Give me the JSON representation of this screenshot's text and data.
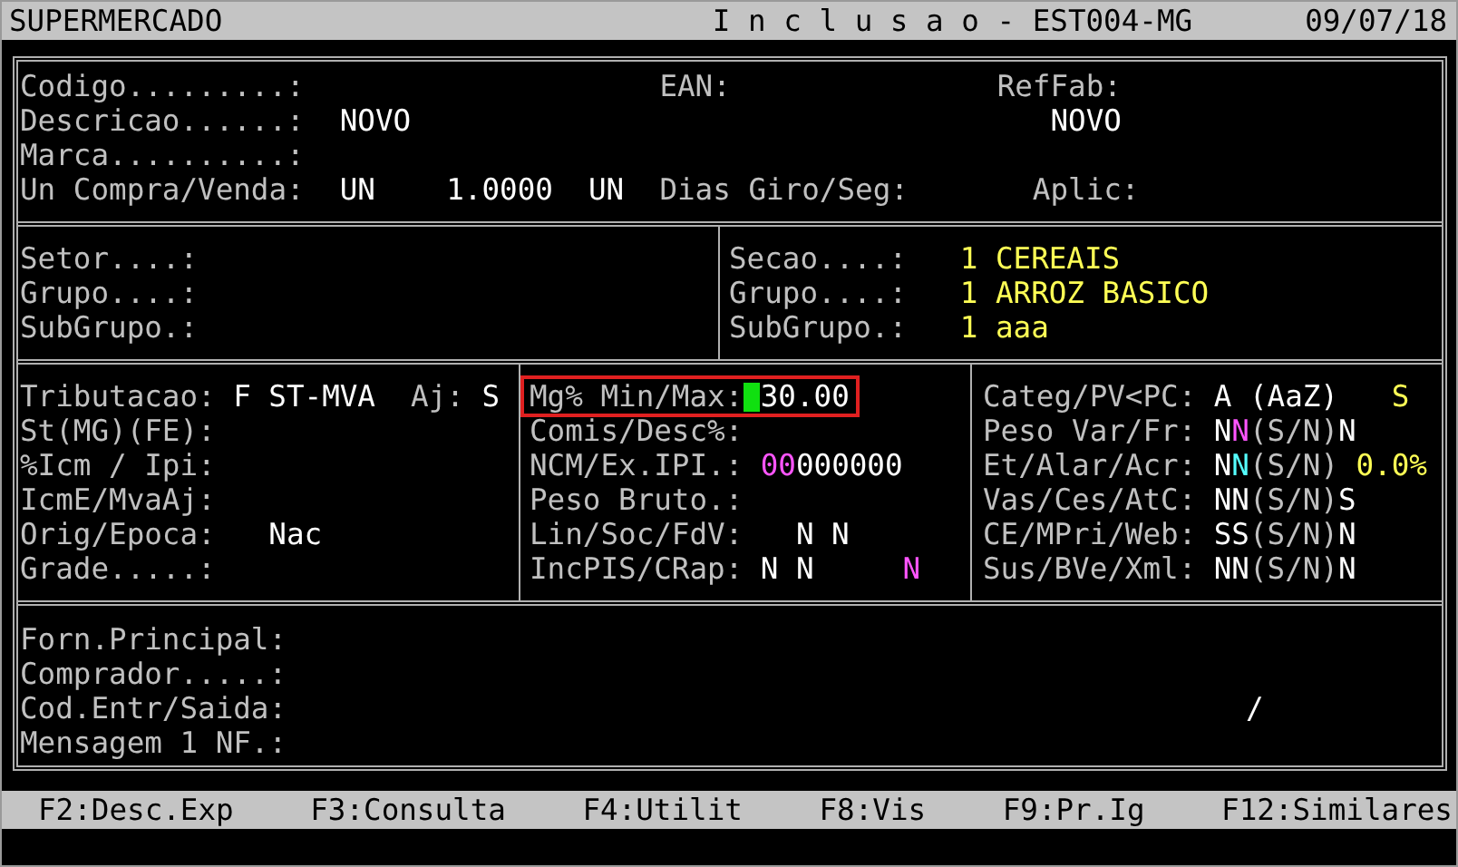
{
  "title_bar": {
    "system": "SUPERMERCADO",
    "screen": "I n c l u s a o - EST004-MG",
    "date": "09/07/18"
  },
  "sections": [
    {
      "panels": [
        {
          "lines": [
            {
              "items": [
                {
                  "kind": "label",
                  "text": "Codigo.........:"
                },
                {
                  "kind": "label",
                  "text": "EAN:"
                },
                {
                  "kind": "label",
                  "text": "RefFab:"
                }
              ]
            },
            {
              "items": [
                {
                  "kind": "label",
                  "text": "Descricao......:"
                },
                {
                  "kind": "value",
                  "parts": [
                    {
                      "text": "NOVO",
                      "color": "#ffffff"
                    }
                  ]
                },
                {
                  "kind": "value",
                  "parts": [
                    {
                      "text": "NOVO",
                      "color": "#ffffff"
                    }
                  ]
                }
              ]
            },
            {
              "items": [
                {
                  "kind": "label",
                  "text": "Marca..........:"
                }
              ]
            },
            {
              "items": [
                {
                  "kind": "label",
                  "text": "Un Compra/Venda:"
                },
                {
                  "kind": "value",
                  "parts": [
                    {
                      "text": "UN",
                      "color": "#ffffff"
                    }
                  ]
                },
                {
                  "kind": "value",
                  "parts": [
                    {
                      "text": "1.0000",
                      "color": "#ffffff"
                    }
                  ]
                },
                {
                  "kind": "value",
                  "parts": [
                    {
                      "text": "UN",
                      "color": "#ffffff"
                    }
                  ]
                },
                {
                  "kind": "label",
                  "text": "Dias Giro/Seg:"
                },
                {
                  "kind": "label",
                  "text": "Aplic:"
                }
              ]
            }
          ]
        }
      ]
    },
    {
      "panels": [
        {
          "lines": [
            {
              "items": [
                {
                  "kind": "label",
                  "text": "Setor....:"
                }
              ]
            },
            {
              "items": [
                {
                  "kind": "label",
                  "text": "Grupo....:"
                }
              ]
            },
            {
              "items": [
                {
                  "kind": "label",
                  "text": "SubGrupo.:"
                }
              ]
            }
          ]
        },
        {
          "lines": [
            {
              "items": [
                {
                  "kind": "label",
                  "text": "Secao....:"
                },
                {
                  "kind": "value",
                  "parts": [
                    {
                      "text": "1 CEREAIS",
                      "color": "#ffff55"
                    }
                  ]
                }
              ]
            },
            {
              "items": [
                {
                  "kind": "label",
                  "text": "Grupo....:"
                },
                {
                  "kind": "value",
                  "parts": [
                    {
                      "text": "1 ARROZ BASICO",
                      "color": "#ffff55"
                    }
                  ]
                }
              ]
            },
            {
              "items": [
                {
                  "kind": "label",
                  "text": "SubGrupo.:"
                },
                {
                  "kind": "value",
                  "parts": [
                    {
                      "text": "1 aaa",
                      "color": "#ffff55"
                    }
                  ]
                }
              ]
            }
          ]
        }
      ]
    },
    {
      "panels": [
        {
          "lines": [
            {
              "items": [
                {
                  "kind": "label",
                  "text": "Tributacao:"
                },
                {
                  "kind": "value",
                  "parts": [
                    {
                      "text": "F",
                      "color": "#ffffff"
                    }
                  ]
                },
                {
                  "kind": "value",
                  "parts": [
                    {
                      "text": "ST-MVA",
                      "color": "#ffffff"
                    }
                  ]
                },
                {
                  "kind": "label",
                  "text": "Aj:"
                },
                {
                  "kind": "value",
                  "parts": [
                    {
                      "text": "S",
                      "color": "#ffffff"
                    }
                  ]
                }
              ]
            },
            {
              "items": [
                {
                  "kind": "label",
                  "text": "St(MG)(FE):"
                }
              ]
            },
            {
              "items": [
                {
                  "kind": "label",
                  "text": "%Icm / Ipi:"
                }
              ]
            },
            {
              "items": [
                {
                  "kind": "label",
                  "text": "IcmE/MvaAj:"
                }
              ]
            },
            {
              "items": [
                {
                  "kind": "label",
                  "text": "Orig/Epoca:"
                },
                {
                  "kind": "value",
                  "parts": [
                    {
                      "text": "Nac",
                      "color": "#ffffff"
                    }
                  ]
                }
              ]
            },
            {
              "items": [
                {
                  "kind": "label",
                  "text": "Grade.....:"
                }
              ]
            }
          ]
        },
        {
          "lines": [
            {
              "items": [
                {
                  "kind": "label",
                  "text": "Mg% Min/Max:"
                },
                {
                  "kind": "value",
                  "focused": true,
                  "parts": [
                    {
                      "text": "30.00"
                    }
                  ]
                }
              ]
            },
            {
              "items": [
                {
                  "kind": "label",
                  "text": "Comis/Desc%:"
                }
              ]
            },
            {
              "items": [
                {
                  "kind": "label",
                  "text": "NCM/Ex.IPI.:"
                },
                {
                  "kind": "value",
                  "parts": [
                    {
                      "text": "00",
                      "color": "#ff55ff"
                    },
                    {
                      "text": "000000",
                      "color": "#ffffff"
                    }
                  ]
                }
              ]
            },
            {
              "items": [
                {
                  "kind": "label",
                  "text": "Peso Bruto.:"
                }
              ]
            },
            {
              "items": [
                {
                  "kind": "label",
                  "text": "Lin/Soc/FdV:"
                },
                {
                  "kind": "value",
                  "parts": [
                    {
                      "text": "N N",
                      "color": "#ffffff"
                    }
                  ]
                }
              ]
            },
            {
              "items": [
                {
                  "kind": "label",
                  "text": "IncPIS/CRap:"
                },
                {
                  "kind": "value",
                  "parts": [
                    {
                      "text": "N N",
                      "color": "#ffffff"
                    }
                  ]
                },
                {
                  "kind": "value",
                  "parts": [
                    {
                      "text": "N",
                      "color": "#ff55ff"
                    }
                  ]
                }
              ]
            }
          ]
        },
        {
          "lines": [
            {
              "items": [
                {
                  "kind": "label",
                  "text": "Categ/PV<PC:"
                },
                {
                  "kind": "value",
                  "parts": [
                    {
                      "text": "A (AaZ)",
                      "color": "#ffffff"
                    }
                  ]
                },
                {
                  "kind": "value",
                  "parts": [
                    {
                      "text": "S",
                      "color": "#ffff55"
                    }
                  ]
                }
              ]
            },
            {
              "items": [
                {
                  "kind": "label",
                  "text": "Peso Var/Fr:"
                },
                {
                  "kind": "value",
                  "parts": [
                    {
                      "text": "N",
                      "color": "#ffffff"
                    },
                    {
                      "text": "N",
                      "color": "#ff55ff"
                    },
                    {
                      "text": "(S/N)",
                      "color": "#c0c0c0"
                    },
                    {
                      "text": "N",
                      "color": "#ffffff"
                    }
                  ]
                }
              ]
            },
            {
              "items": [
                {
                  "kind": "label",
                  "text": "Et/Alar/Acr:"
                },
                {
                  "kind": "value",
                  "parts": [
                    {
                      "text": "N",
                      "color": "#ffffff"
                    },
                    {
                      "text": "N",
                      "color": "#55ffff"
                    },
                    {
                      "text": "(S/N)",
                      "color": "#c0c0c0"
                    }
                  ]
                },
                {
                  "kind": "value",
                  "parts": [
                    {
                      "text": "0.0%",
                      "color": "#ffff55"
                    }
                  ]
                }
              ]
            },
            {
              "items": [
                {
                  "kind": "label",
                  "text": "Vas/Ces/AtC:"
                },
                {
                  "kind": "value",
                  "parts": [
                    {
                      "text": "NN",
                      "color": "#ffffff"
                    },
                    {
                      "text": "(S/N)",
                      "color": "#c0c0c0"
                    },
                    {
                      "text": "S",
                      "color": "#ffffff"
                    }
                  ]
                }
              ]
            },
            {
              "items": [
                {
                  "kind": "label",
                  "text": "CE/MPri/Web:"
                },
                {
                  "kind": "value",
                  "parts": [
                    {
                      "text": "SS",
                      "color": "#ffffff"
                    },
                    {
                      "text": "(S/N)",
                      "color": "#c0c0c0"
                    },
                    {
                      "text": "N",
                      "color": "#ffffff"
                    }
                  ]
                }
              ]
            },
            {
              "items": [
                {
                  "kind": "label",
                  "text": "Sus/BVe/Xml:"
                },
                {
                  "kind": "value",
                  "parts": [
                    {
                      "text": "NN",
                      "color": "#ffffff"
                    },
                    {
                      "text": "(S/N)",
                      "color": "#c0c0c0"
                    },
                    {
                      "text": "N",
                      "color": "#ffffff"
                    }
                  ]
                }
              ]
            }
          ]
        }
      ]
    },
    {
      "panels": [
        {
          "lines": [
            {
              "items": [
                {
                  "kind": "label",
                  "text": "Forn.Principal:"
                }
              ]
            },
            {
              "items": [
                {
                  "kind": "label",
                  "text": "Comprador.....:"
                }
              ]
            },
            {
              "items": [
                {
                  "kind": "label",
                  "text": "Cod.Entr/Saida:"
                },
                {
                  "kind": "value",
                  "parts": [
                    {
                      "text": "/",
                      "color": "#ffffff"
                    }
                  ]
                }
              ]
            },
            {
              "items": [
                {
                  "kind": "label",
                  "text": "Mensagem 1 NF.:"
                }
              ]
            }
          ]
        }
      ]
    }
  ],
  "function_keys": [
    "F2:Desc.Exp",
    "F3:Consulta",
    "F4:Utilit",
    "F8:Vis",
    "F9:Pr.Ig",
    "F12:Similares"
  ]
}
